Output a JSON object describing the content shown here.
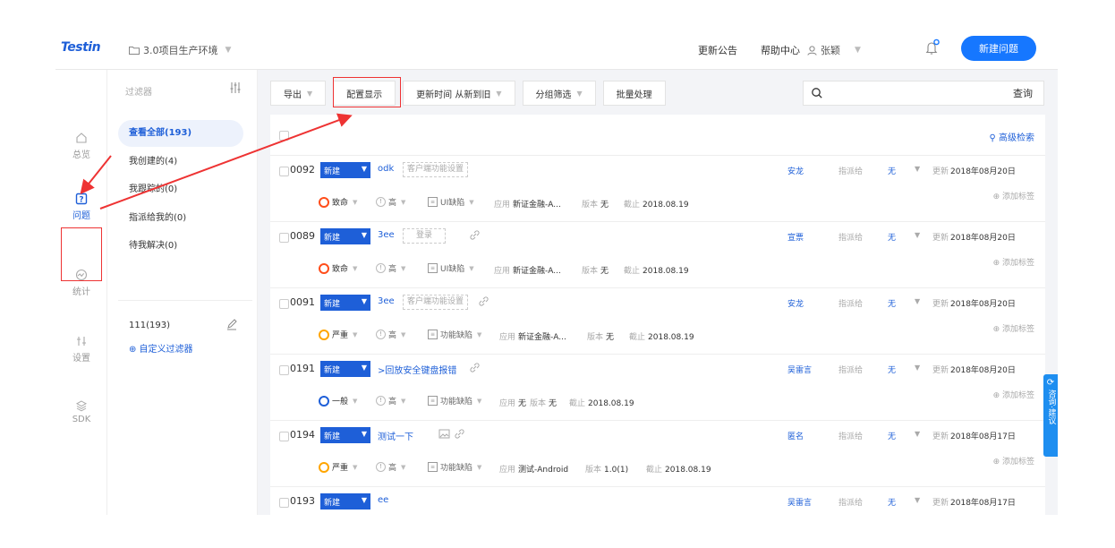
{
  "header": {
    "logo": "Testin",
    "project": "3.0项目生产环境",
    "links": [
      "更新公告",
      "帮助中心"
    ],
    "user": "张颖",
    "new_issue": "新建问题"
  },
  "leftnav": [
    {
      "label": "总览",
      "icon": "home-icon"
    },
    {
      "label": "问题",
      "icon": "question-icon"
    },
    {
      "label": "统计",
      "icon": "chart-icon"
    },
    {
      "label": "设置",
      "icon": "settings-icon"
    },
    {
      "label": "SDK",
      "icon": "layers-icon"
    }
  ],
  "filters": {
    "title": "过滤器",
    "items": [
      "查看全部(193)",
      "我创建的(4)",
      "我跟踪的(0)",
      "指派给我的(0)",
      "待我解决(0)"
    ],
    "custom": "111(193)",
    "add_custom": "⊕ 自定义过滤器"
  },
  "toolbar": {
    "export": "导出",
    "config": "配置显示",
    "sort": "更新时间 从新到旧",
    "group": "分组筛选",
    "batch": "批量处理",
    "search_btn": "查询",
    "advanced": "高级检索"
  },
  "issues": [
    {
      "id": "0092",
      "status": "新建",
      "title": "odk",
      "tag": "客户端功能设置",
      "owner": "安龙",
      "assign": "指派给",
      "none": "无",
      "updated_lbl": "更新",
      "updated": "2018年08月20日",
      "severity": "致命",
      "priority": "高",
      "type": "UI缺陷",
      "app_k": "应用",
      "app": "新证金融-A...",
      "ver_k": "版本",
      "ver": "无",
      "due_k": "截止",
      "due": "2018.08.19",
      "add_tag": "⊕ 添加标签"
    },
    {
      "id": "0089",
      "status": "新建",
      "title": "3ee",
      "tag": "登录",
      "owner": "宣票",
      "assign": "指派给",
      "none": "无",
      "updated_lbl": "更新",
      "updated": "2018年08月20日",
      "severity": "致命",
      "priority": "高",
      "type": "UI缺陷",
      "app_k": "应用",
      "app": "新证金融-A...",
      "ver_k": "版本",
      "ver": "无",
      "due_k": "截止",
      "due": "2018.08.19",
      "add_tag": "⊕ 添加标签"
    },
    {
      "id": "0091",
      "status": "新建",
      "title": "3ee",
      "tag": "客户端功能设置",
      "owner": "安龙",
      "assign": "指派给",
      "none": "无",
      "updated_lbl": "更新",
      "updated": "2018年08月20日",
      "severity": "严重",
      "priority": "高",
      "type": "功能缺陷",
      "app_k": "应用",
      "app": "新证金融-A...",
      "ver_k": "版本",
      "ver": "无",
      "due_k": "截止",
      "due": "2018.08.19",
      "add_tag": "⊕ 添加标签"
    },
    {
      "id": "0191",
      "status": "新建",
      "title": ">回放安全键盘报错",
      "tag": "",
      "owner": "吴雷言",
      "assign": "指派给",
      "none": "无",
      "updated_lbl": "更新",
      "updated": "2018年08月20日",
      "severity": "一般",
      "priority": "高",
      "type": "功能缺陷",
      "app_k": "应用",
      "app": "无",
      "ver_k": "版本",
      "ver": "无",
      "due_k": "截止",
      "due": "2018.08.19",
      "add_tag": "⊕ 添加标签"
    },
    {
      "id": "0194",
      "status": "新建",
      "title": "测试一下",
      "tag": "",
      "owner": "匿名",
      "assign": "指派给",
      "none": "无",
      "updated_lbl": "更新",
      "updated": "2018年08月17日",
      "severity": "严重",
      "priority": "高",
      "type": "功能缺陷",
      "app_k": "应用",
      "app": "测试-Android",
      "ver_k": "版本",
      "ver": "1.0(1)",
      "due_k": "截止",
      "due": "2018.08.19",
      "add_tag": "⊕ 添加标签"
    },
    {
      "id": "0193",
      "status": "新建",
      "title": "ee",
      "tag": "",
      "owner": "吴雷言",
      "assign": "指派给",
      "none": "无",
      "updated_lbl": "更新",
      "updated": "2018年08月17日"
    }
  ],
  "float": "咨询·建议",
  "colors": {
    "primary": "#1e5fd8",
    "accent": "#1677ff",
    "annotation": "#e33"
  }
}
